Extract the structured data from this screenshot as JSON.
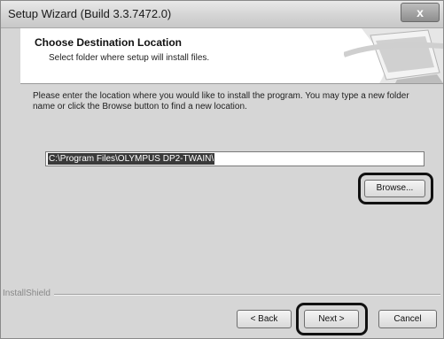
{
  "window": {
    "title": "Setup Wizard (Build 3.3.7472.0)",
    "close_label": "x"
  },
  "header": {
    "title": "Choose Destination Location",
    "subtitle": "Select folder where setup will install files."
  },
  "main": {
    "instructions": "Please enter the location where you would like to install the program.  You may type a new folder name or click the Browse button to find a new location.",
    "destination_path": "C:\\Program Files\\OLYMPUS DP2-TWAIN\\",
    "browse_label": "Browse..."
  },
  "footer": {
    "brand": "InstallShield",
    "back_label": "< Back",
    "next_label": "Next >",
    "cancel_label": "Cancel"
  }
}
